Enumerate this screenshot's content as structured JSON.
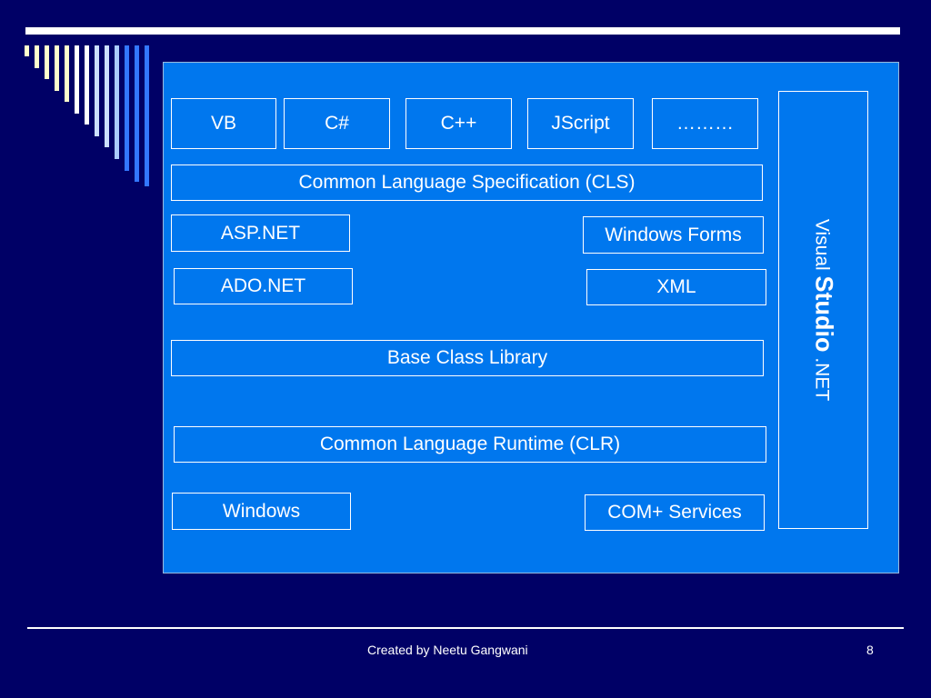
{
  "diagram": {
    "languages": [
      "VB",
      "C#",
      "C++",
      "JScript",
      "………"
    ],
    "cls_label": "Common Language Specification (CLS)",
    "asp_label": "ASP.NET",
    "winforms_label": "Windows Forms",
    "ado_label": "ADO.NET",
    "xml_label": "XML",
    "bcl_label": "Base Class Library",
    "clr_label": "Common Language Runtime (CLR)",
    "windows_label": "Windows",
    "com_label": "COM+ Services",
    "vs": {
      "part1": "Visual ",
      "part2": "Studio",
      "part3": " .NET"
    }
  },
  "footer": {
    "credit": "Created by Neetu Gangwani",
    "page_number": "8"
  },
  "colors": {
    "background": "#000066",
    "panel": "#0077ee",
    "stripe_light": "#ffffcc",
    "stripe_pale_blue": "#cce0ff",
    "stripe_blue": "#3377ff"
  }
}
